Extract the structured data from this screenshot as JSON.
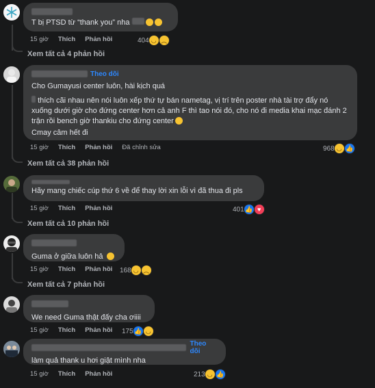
{
  "comments": [
    {
      "id": 1,
      "text": "T bị PTSD từ “thank you” nha",
      "time": "15 giờ",
      "like": "Thích",
      "reply": "Phản hồi",
      "react_count": "404",
      "see_more": "Xem tất cả 4 phản hồi"
    },
    {
      "id": 2,
      "follow": "Theo dõi",
      "line1": "Cho Gumayusi center luôn, hài kịch quá",
      "line2": "thích cãi nhau nên nói luôn xếp thứ tự bán nametag, vị trí trên poster nhà tài trợ đẩy nó xuống dưới giờ cho đứng center hơn cả anh F thì tao nói đó, cho nó đi media khai mạc đánh 2 trận rồi bench giờ thankiu cho đứng center",
      "line3": "Cmay câm hết đi",
      "time": "15 giờ",
      "like": "Thích",
      "reply": "Phản hồi",
      "edited": "Đã chỉnh sửa",
      "react_count": "968",
      "see_more": "Xem tất cả 38 phản hồi"
    },
    {
      "id": 3,
      "name": "...i Trường",
      "text": "Hãy mang chiếc cúp thứ 6 về để thay lời xin lỗi vì đã thua đi pls",
      "time": "15 giờ",
      "like": "Thích",
      "reply": "Phản hồi",
      "react_count": "401",
      "see_more": "Xem tất cả 10 phản hồi"
    },
    {
      "id": 4,
      "text": "Guma ở giữa luôn hả",
      "time": "15 giờ",
      "like": "Thích",
      "reply": "Phản hồi",
      "react_count": "168",
      "see_more": "Xem tất cả 7 phản hồi"
    },
    {
      "id": 5,
      "text": "We need Guma thật đấy cha ơiiii",
      "time": "15 giờ",
      "like": "Thích",
      "reply": "Phản hồi",
      "react_count": "175"
    },
    {
      "id": 6,
      "follow": "Theo dõi",
      "text": "làm quả thank u hơi giật mình nha",
      "time": "15 giờ",
      "like": "Thích",
      "reply": "Phản hồi",
      "react_count": "213"
    }
  ],
  "colors": {
    "background": "#18191a",
    "bubble": "#3a3b3c",
    "link": "#2d88ff",
    "muted": "#b0b3b8"
  },
  "icons": [
    "haha-reaction-icon",
    "like-reaction-icon",
    "sad-reaction-icon",
    "love-reaction-icon"
  ]
}
